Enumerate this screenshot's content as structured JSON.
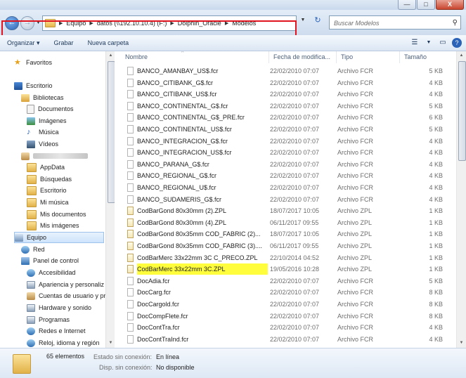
{
  "window": {
    "buttons": {
      "minimize": "—",
      "maximize": "□",
      "close": "X"
    }
  },
  "address": {
    "back_glyph": "←",
    "forward_glyph": "→",
    "crumbs": [
      "Equipo",
      "datos (\\\\192.10.10.4) (F:)",
      "Dolphin_Oracle",
      "Modelos"
    ],
    "search_placeholder": "Buscar Modelos",
    "highlight_color": "#e0141e"
  },
  "toolbar": {
    "organize": "Organizar ▾",
    "record": "Grabar",
    "new_folder": "Nueva carpeta"
  },
  "nav": {
    "favorites": "Favoritos",
    "desktop": "Escritorio",
    "libraries": "Bibliotecas",
    "documents": "Documentos",
    "images": "Imágenes",
    "music": "Música",
    "videos": "Vídeos",
    "appdata": "AppData",
    "searches": "Búsquedas",
    "desktop2": "Escritorio",
    "my_music": "Mi música",
    "my_documents": "Mis documentos",
    "my_images": "Mis imágenes",
    "computer": "Equipo",
    "network": "Red",
    "control_panel": "Panel de control",
    "accessibility": "Accesibilidad",
    "appearance": "Apariencia y personaliz",
    "user_accounts": "Cuentas de usuario y pr",
    "hardware": "Hardware y sonido",
    "programs": "Programas",
    "network_internet": "Redes e Internet",
    "clock": "Reloj, idioma y región"
  },
  "columns": {
    "name": "Nombre",
    "date": "Fecha de modifica...",
    "type": "Tipo",
    "size": "Tamaño"
  },
  "files": [
    {
      "name": "BANCO_AMANBAY_US$.fcr",
      "date": "22/02/2010 07:07",
      "type": "Archivo FCR",
      "size": "5 KB"
    },
    {
      "name": "BANCO_CITIBANK_G$.fcr",
      "date": "22/02/2010 07:07",
      "type": "Archivo FCR",
      "size": "4 KB"
    },
    {
      "name": "BANCO_CITIBANK_US$.fcr",
      "date": "22/02/2010 07:07",
      "type": "Archivo FCR",
      "size": "4 KB"
    },
    {
      "name": "BANCO_CONTINENTAL_G$.fcr",
      "date": "22/02/2010 07:07",
      "type": "Archivo FCR",
      "size": "5 KB"
    },
    {
      "name": "BANCO_CONTINENTAL_G$_PRE.fcr",
      "date": "22/02/2010 07:07",
      "type": "Archivo FCR",
      "size": "6 KB"
    },
    {
      "name": "BANCO_CONTINENTAL_US$.fcr",
      "date": "22/02/2010 07:07",
      "type": "Archivo FCR",
      "size": "5 KB"
    },
    {
      "name": "BANCO_INTEGRACION_G$.fcr",
      "date": "22/02/2010 07:07",
      "type": "Archivo FCR",
      "size": "4 KB"
    },
    {
      "name": "BANCO_INTEGRACION_US$.fcr",
      "date": "22/02/2010 07:07",
      "type": "Archivo FCR",
      "size": "4 KB"
    },
    {
      "name": "BANCO_PARANA_G$.fcr",
      "date": "22/02/2010 07:07",
      "type": "Archivo FCR",
      "size": "4 KB"
    },
    {
      "name": "BANCO_REGIONAL_G$.fcr",
      "date": "22/02/2010 07:07",
      "type": "Archivo FCR",
      "size": "4 KB"
    },
    {
      "name": "BANCO_REGIONAL_U$.fcr",
      "date": "22/02/2010 07:07",
      "type": "Archivo FCR",
      "size": "4 KB"
    },
    {
      "name": "BANCO_SUDAMERIS_G$.fcr",
      "date": "22/02/2010 07:07",
      "type": "Archivo FCR",
      "size": "4 KB"
    },
    {
      "name": "CodBarGond 80x30mm (2).ZPL",
      "date": "18/07/2017 10:05",
      "type": "Archivo ZPL",
      "size": "1 KB"
    },
    {
      "name": "CodBarGond 80x30mm (4).ZPL",
      "date": "06/11/2017 09:55",
      "type": "Archivo ZPL",
      "size": "1 KB"
    },
    {
      "name": "CodBarGond 80x35mm COD_FABRIC (2)...",
      "date": "18/07/2017 10:05",
      "type": "Archivo ZPL",
      "size": "1 KB"
    },
    {
      "name": "CodBarGond 80x35mm COD_FABRIC (3)....",
      "date": "06/11/2017 09:55",
      "type": "Archivo ZPL",
      "size": "1 KB"
    },
    {
      "name": "CodBarMerc 33x22mm 3C C_PRECO.ZPL",
      "date": "22/10/2014 04:52",
      "type": "Archivo ZPL",
      "size": "1 KB"
    },
    {
      "name": "CodBarMerc 33x22mm 3C.ZPL",
      "date": "19/05/2016 10:28",
      "type": "Archivo ZPL",
      "size": "1 KB"
    },
    {
      "name": "DocAdia.fcr",
      "date": "22/02/2010 07:07",
      "type": "Archivo FCR",
      "size": "5 KB"
    },
    {
      "name": "DocCarg.fcr",
      "date": "22/02/2010 07:07",
      "type": "Archivo FCR",
      "size": "8 KB"
    },
    {
      "name": "DocCargold.fcr",
      "date": "22/02/2010 07:07",
      "type": "Archivo FCR",
      "size": "8 KB"
    },
    {
      "name": "DocCompFlete.fcr",
      "date": "22/02/2010 07:07",
      "type": "Archivo FCR",
      "size": "8 KB"
    },
    {
      "name": "DocContTra.fcr",
      "date": "22/02/2010 07:07",
      "type": "Archivo FCR",
      "size": "4 KB"
    },
    {
      "name": "DocContTraInd.fcr",
      "date": "22/02/2010 07:07",
      "type": "Archivo FCR",
      "size": "4 KB"
    }
  ],
  "highlight_color": "#fffd3c",
  "status": {
    "count": "65 elementos",
    "offline_status_label": "Estado sin conexión:",
    "offline_status_value": "En línea",
    "offline_avail_label": "Disp. sin conexión:",
    "offline_avail_value": "No disponible"
  }
}
